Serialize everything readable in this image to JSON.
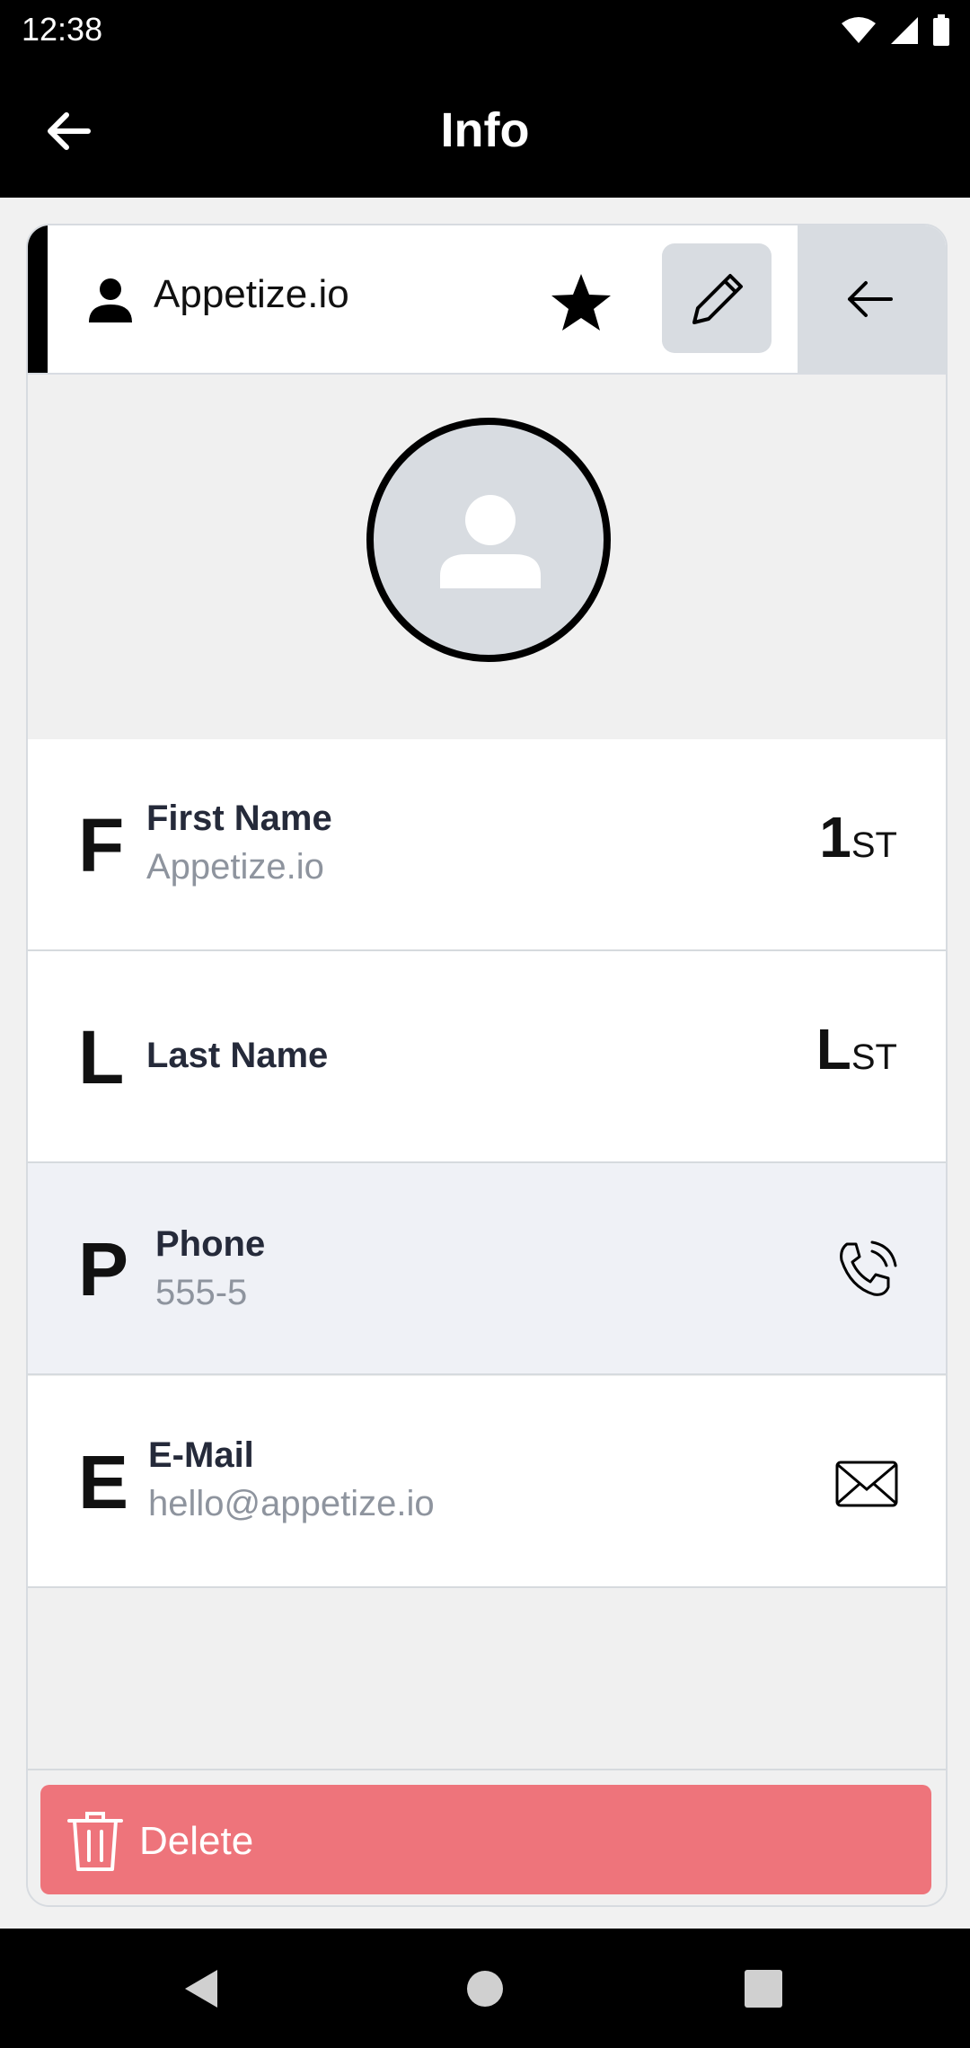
{
  "status_bar": {
    "time": "12:38"
  },
  "app_bar": {
    "title": "Info"
  },
  "contact": {
    "name": "Appetize.io"
  },
  "fields": {
    "first_name": {
      "letter": "F",
      "label": "First Name",
      "value": "Appetize.io",
      "ordinal_big": "1",
      "ordinal_small": "ST"
    },
    "last_name": {
      "letter": "L",
      "label": "Last Name",
      "value": "",
      "ordinal_big": "L",
      "ordinal_small": "ST"
    },
    "phone": {
      "letter": "P",
      "label": "Phone",
      "value": "555-5"
    },
    "email": {
      "letter": "E",
      "label": "E-Mail",
      "value": "hello@appetize.io"
    }
  },
  "actions": {
    "delete_label": "Delete"
  },
  "colors": {
    "delete_button": "#ee747b",
    "header_bg": "#000000",
    "highlight_row": "#eff1f6"
  }
}
